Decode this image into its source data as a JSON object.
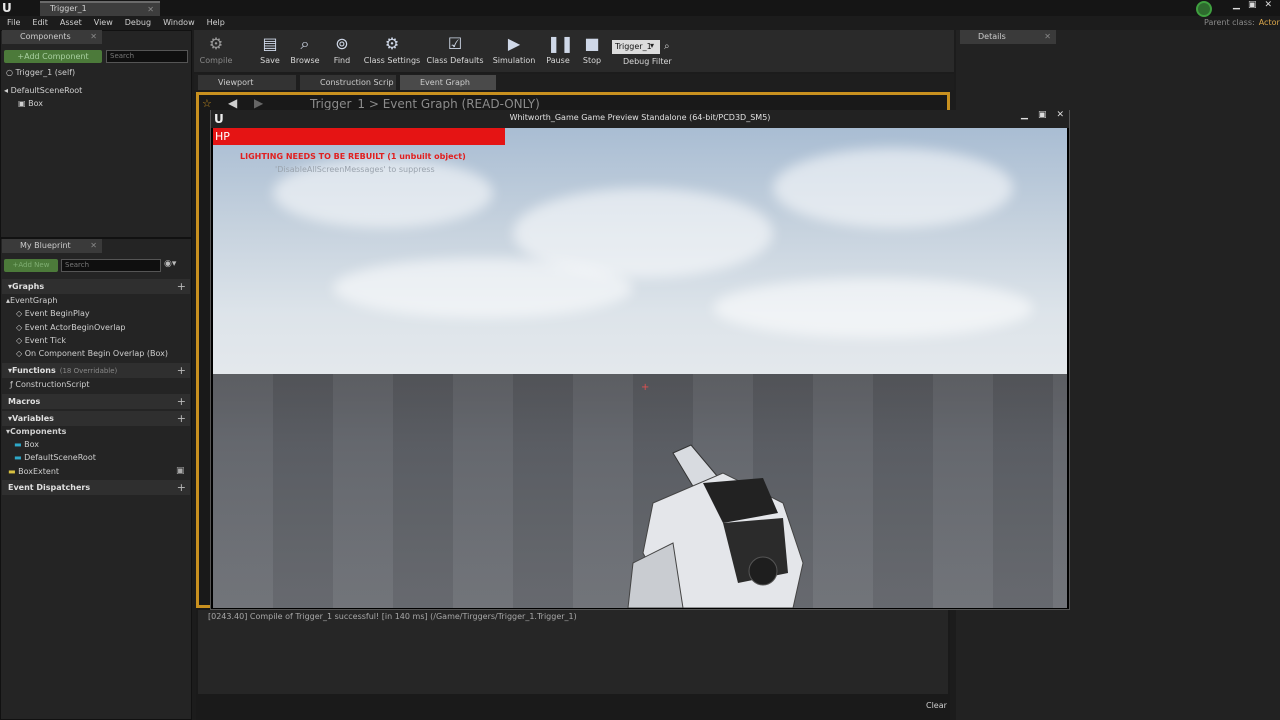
{
  "window": {
    "tab": "Trigger_1",
    "parent_class_label": "Parent class:",
    "parent_class_value": "Actor"
  },
  "menu": [
    "File",
    "Edit",
    "Asset",
    "View",
    "Debug",
    "Window",
    "Help"
  ],
  "components": {
    "tab": "Components",
    "add_label": "+Add Component",
    "search_placeholder": "Search",
    "self": "Trigger_1 (self)",
    "root": "DefaultSceneRoot",
    "child": "Box"
  },
  "toolbar": {
    "compile": "Compile",
    "save": "Save",
    "browse": "Browse",
    "find": "Find",
    "class_settings": "Class Settings",
    "class_defaults": "Class Defaults",
    "simulation": "Simulation",
    "pause": "Pause",
    "stop": "Stop",
    "debug_object": "Trigger_1",
    "debug_filter": "Debug Filter"
  },
  "graph_tabs": [
    "Viewport",
    "Construction Scrip",
    "Event Graph"
  ],
  "breadcrumb": "Trigger_1 > Event Graph (READ-ONLY)",
  "my_blueprint": {
    "tab": "My Blueprint",
    "add_label": "+Add New",
    "search_placeholder": "Search",
    "graphs": "Graphs",
    "event_graph": "EventGraph",
    "events": [
      "Event BeginPlay",
      "Event ActorBeginOverlap",
      "Event Tick",
      "On Component Begin Overlap (Box)"
    ],
    "functions": "Functions",
    "functions_sub": "(18 Overridable)",
    "construction_script": "ConstructionScript",
    "macros": "Macros",
    "variables": "Variables",
    "var_components": "Components",
    "var_items": [
      "Box",
      "DefaultSceneRoot"
    ],
    "box_extent": "BoxExtent",
    "dispatchers": "Event Dispatchers"
  },
  "details": {
    "tab": "Details"
  },
  "game": {
    "title": "Whitworth_Game Game Preview Standalone (64-bit/PCD3D_SM5)",
    "hp": "HP",
    "lighting_msg": "LIGHTING NEEDS TO BE REBUILT (1 unbuilt object)",
    "suppress_msg": "'DisableAllScreenMessages' to suppress"
  },
  "log": {
    "line": "[0243.40] Compile of Trigger_1 successful! [in 140 ms] (/Game/Tirggers/Trigger_1.Trigger_1)",
    "clear": "Clear"
  },
  "colors": {
    "accent_orange": "#c8901f",
    "hp_red": "#e51414",
    "add_green": "#4c7a3a"
  }
}
